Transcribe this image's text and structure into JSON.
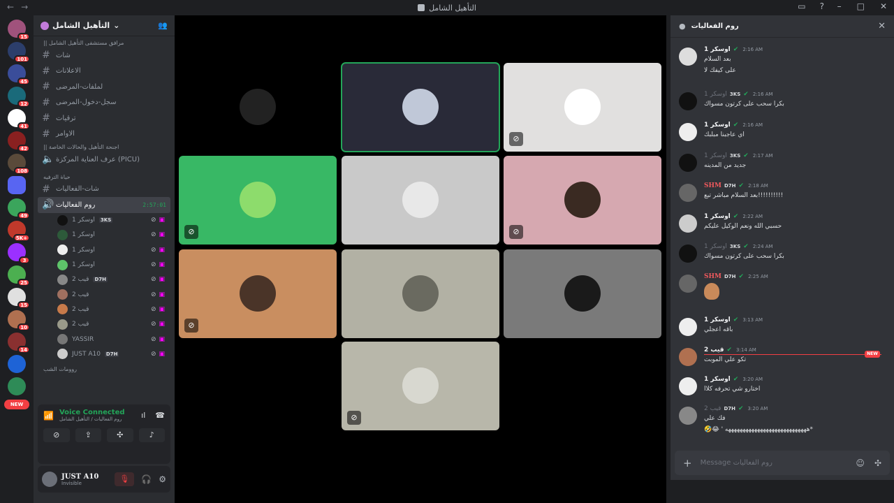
{
  "window": {
    "title": "التأهيل الشامل",
    "back_icon": "←",
    "forward_icon": "→"
  },
  "servers": [
    {
      "badge": "15",
      "color": "#a0527c"
    },
    {
      "badge": "101",
      "color": "#2c3e6b"
    },
    {
      "badge": "45",
      "color": "#3a4d9a"
    },
    {
      "badge": "12",
      "color": "#1a6a7a"
    },
    {
      "badge": "41",
      "color": "#ffffff"
    },
    {
      "badge": "42",
      "color": "#8a2020"
    },
    {
      "badge": "108",
      "color": "#5a4a3a"
    },
    {
      "badge": "",
      "color": "#5865f2"
    },
    {
      "badge": "49",
      "color": "#3ba55c"
    },
    {
      "badge": "5K+",
      "color": "#c0392b"
    },
    {
      "badge": "3",
      "color": "#9b30ff"
    },
    {
      "badge": "25",
      "color": "#4caf50"
    },
    {
      "badge": "15",
      "color": "#e0e0e0"
    },
    {
      "badge": "10",
      "color": "#b07050"
    },
    {
      "badge": "14",
      "color": "#8a3030"
    },
    {
      "badge": "",
      "color": "#1e63d6"
    },
    {
      "badge": "",
      "color": "#2e8b57"
    }
  ],
  "servers_new_label": "NEW",
  "guild": {
    "name": "التأهيل الشامل"
  },
  "channels": {
    "cat1": "مرافق مستشفى التأهيل الشامل ||",
    "text": [
      "شات",
      "الاعلانات",
      "لملفات-المرضى",
      "سجل-دخول-المرضى",
      "ترقيات",
      "الاوامر"
    ],
    "cat2": "اجنحة التأهيل والحالات الخاصة ||",
    "voice1": "عرف العناية المركزة (PICU)",
    "cat3": "حياة الترفيه",
    "text2": "شات-الفعاليات",
    "active_voice": "روم الفعاليات",
    "active_time": "2:57:01",
    "cat4": "روومات الشب"
  },
  "voice_users": [
    {
      "name": "اوسكر 1",
      "tag": "3KS",
      "color": "#111"
    },
    {
      "name": "اوسكر 1",
      "tag": "",
      "color": "#2d5a3a"
    },
    {
      "name": "اوسكر 1",
      "tag": "",
      "color": "#eee"
    },
    {
      "name": "اوسكر 1",
      "tag": "",
      "color": "#5ec46a"
    },
    {
      "name": "قيب 2",
      "tag": "D7H",
      "color": "#888"
    },
    {
      "name": "قيب 2",
      "tag": "",
      "color": "#a07060"
    },
    {
      "name": "قيب 2",
      "tag": "",
      "color": "#c77a4a"
    },
    {
      "name": "قيب 2",
      "tag": "",
      "color": "#9a9a8a"
    },
    {
      "name": "YASSIR",
      "tag": "",
      "color": "#777"
    },
    {
      "name": "JUST A10",
      "tag": "D7H",
      "color": "#ccc"
    }
  ],
  "voice_panel": {
    "title": "Voice Connected",
    "subtitle": "روم الفعاليات / التأهيل الشامل"
  },
  "user": {
    "name": "JUST A10",
    "status": "Invisible"
  },
  "tiles": [
    {
      "bg": "#000000",
      "av": "#222222",
      "speaking": false,
      "muted": false
    },
    {
      "bg": "#292a38",
      "av": "#c0c8d8",
      "speaking": true,
      "muted": false
    },
    {
      "bg": "#e1e0df",
      "av": "#ffffff",
      "speaking": false,
      "muted": true
    },
    {
      "bg": "#38b865",
      "av": "#8ddc6c",
      "speaking": false,
      "muted": true
    },
    {
      "bg": "#c9c9c9",
      "av": "#e8e8e8",
      "speaking": false,
      "muted": false
    },
    {
      "bg": "#d6a8b0",
      "av": "#3a2a22",
      "speaking": false,
      "muted": true
    },
    {
      "bg": "#c98e60",
      "av": "#4a3428",
      "speaking": false,
      "muted": true
    },
    {
      "bg": "#b2b1a4",
      "av": "#6a6a60",
      "speaking": false,
      "muted": false
    },
    {
      "bg": "#7a7a7a",
      "av": "#1a1a1a",
      "speaking": false,
      "muted": false
    },
    {
      "bg": "#b8b7aa",
      "av": "#d8d8d0",
      "speaking": false,
      "muted": true
    }
  ],
  "chat": {
    "title": "روم الفعاليات",
    "new_label": "NEW",
    "placeholder": "Message روم الفعاليات",
    "messages": [
      {
        "author": "اوسكر 1",
        "tag": "",
        "style": "",
        "time": "2:16 AM",
        "text": "بعد السلام",
        "text2": "على كيفك لا",
        "av": "#ddd"
      },
      {
        "author": "اوسكر 1",
        "tag": "3KS",
        "style": "dim",
        "time": "2:16 AM",
        "text": "بكرا سحب على كرتون مسواك",
        "text2": "",
        "av": "#111"
      },
      {
        "author": "اوسكر 1",
        "tag": "",
        "style": "",
        "time": "2:16 AM",
        "text": "اي عاجبنا مبلبك",
        "text2": "",
        "av": "#eee"
      },
      {
        "author": "اوسكر 1",
        "tag": "3KS",
        "style": "dim",
        "time": "2:17 AM",
        "text": "جديد من المدينه",
        "text2": "",
        "av": "#111"
      },
      {
        "author": "SHM",
        "tag": "D7H",
        "style": "red",
        "time": "2:18 AM",
        "text": "بعد السلام مباشر تبع!!!!!!!!!!",
        "text2": "",
        "av": "#666"
      },
      {
        "author": "اوسكر 1",
        "tag": "",
        "style": "",
        "time": "2:22 AM",
        "text": "حسبي الله ونعم الوكيل عليكم",
        "text2": "",
        "av": "#ccc"
      },
      {
        "author": "اوسكر 1",
        "tag": "3KS",
        "style": "dim",
        "time": "2:24 AM",
        "text": "بكرا سحب على كرتون مسواك",
        "text2": "",
        "av": "#111"
      },
      {
        "author": "SHM",
        "tag": "D7H",
        "style": "red",
        "time": "2:25 AM",
        "text": "",
        "text2": "",
        "av": "#666"
      },
      {
        "author": "اوسكر 1",
        "tag": "",
        "style": "",
        "time": "3:13 AM",
        "text": "باقه اعجلي",
        "text2": "",
        "av": "#eee"
      },
      {
        "author": "قيب 2",
        "tag": "",
        "style": "",
        "time": "3:14 AM",
        "text": "تكو علي الموبت",
        "text2": "",
        "av": "#b07050"
      },
      {
        "author": "اوسكر 1",
        "tag": "",
        "style": "",
        "time": "3:20 AM",
        "text": "اختارو شي تحرفه كلاا",
        "text2": "",
        "av": "#eee"
      },
      {
        "author": "قيب 2",
        "tag": "D7H",
        "style": "dim",
        "time": "3:20 AM",
        "text": "فك علي",
        "text2": "🤣😂 ' ههههههههههههههههههههههههههههه*",
        "av": "#888"
      }
    ]
  }
}
